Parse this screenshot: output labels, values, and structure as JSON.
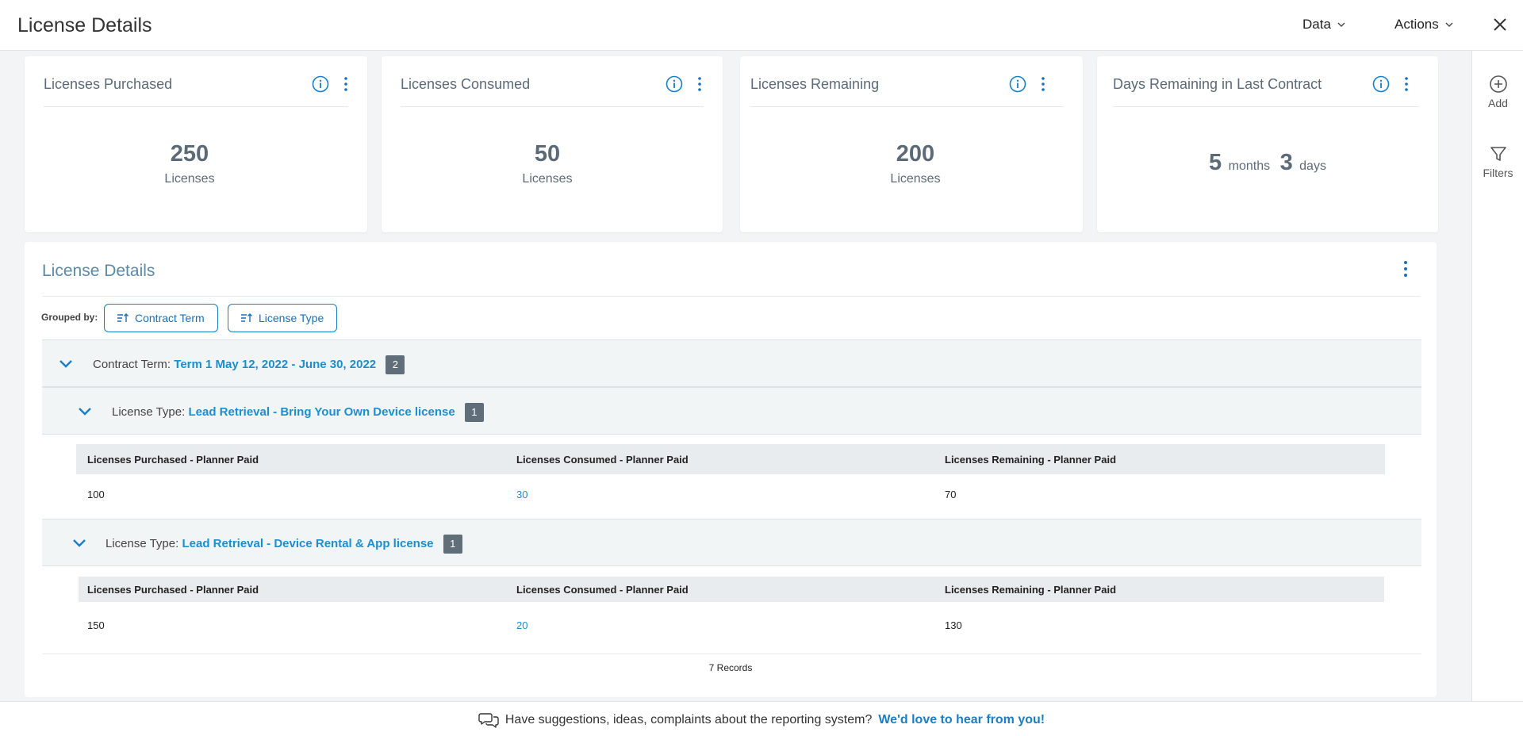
{
  "header": {
    "title": "License Details",
    "menus": [
      {
        "label": "Data"
      },
      {
        "label": "Actions"
      }
    ]
  },
  "rail": {
    "add_label": "Add",
    "filters_label": "Filters"
  },
  "cards": [
    {
      "title": "Licenses Purchased",
      "value": "250",
      "unit": "Licenses"
    },
    {
      "title": "Licenses Consumed",
      "value": "50",
      "unit": "Licenses"
    },
    {
      "title": "Licenses Remaining",
      "value": "200",
      "unit": "Licenses"
    },
    {
      "title": "Days Remaining in Last Contract",
      "months_value": "5",
      "months_label": "months",
      "days_value": "3",
      "days_label": "days"
    }
  ],
  "panel": {
    "title": "License Details",
    "grouped_by_label": "Grouped by:",
    "group_chips": [
      "Contract Term",
      "License Type"
    ],
    "contract_group": {
      "label": "Contract Term:",
      "value": "Term 1 May 12, 2022 - June 30, 2022",
      "count": "2"
    },
    "license_groups": [
      {
        "label": "License Type:",
        "value": "Lead Retrieval - Bring Your Own Device license",
        "count": "1",
        "columns": [
          "Licenses Purchased - Planner Paid",
          "Licenses Consumed - Planner Paid",
          "Licenses Remaining - Planner Paid"
        ],
        "row": [
          "100",
          "30",
          "70"
        ]
      },
      {
        "label": "License Type:",
        "value": "Lead Retrieval - Device Rental & App license",
        "count": "1",
        "columns": [
          "Licenses Purchased - Planner Paid",
          "Licenses Consumed - Planner Paid",
          "Licenses Remaining - Planner Paid"
        ],
        "row": [
          "150",
          "20",
          "130"
        ]
      }
    ],
    "records": "7 Records"
  },
  "footer": {
    "text": "Have suggestions, ideas, complaints about the reporting system?",
    "link": "We'd love to hear from you!"
  },
  "colors": {
    "accent": "#1a8fd1",
    "badge": "#5f6e78",
    "card_text": "#5c6a78"
  }
}
